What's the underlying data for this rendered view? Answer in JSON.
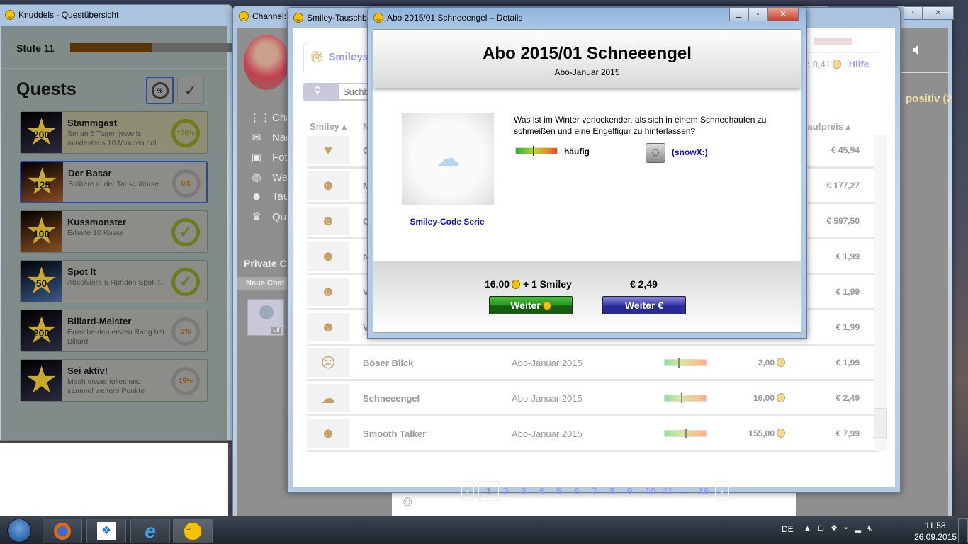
{
  "quest_window": {
    "title": "Knuddels - Questübersicht",
    "level_label": "Stufe 11",
    "level_progress": 0.5,
    "heading": "Quests",
    "filter_percent_icon": "%",
    "filter_check_icon": "✓",
    "quests": [
      {
        "points": "200",
        "title": "Stammgast",
        "desc": "Sei an 5 Tagen jeweils mindestens 10 Minuten onl...",
        "status": "100%",
        "done": false,
        "bg": "#2a2a40"
      },
      {
        "points": "125",
        "title": "Der Basar",
        "desc": "Stöbere in der Tauschbörse",
        "status": "0%",
        "done": false,
        "bg": "#8a4a20"
      },
      {
        "points": "100",
        "title": "Kussmonster",
        "desc": "Erhalte 10 Küsse",
        "status": "✓",
        "done": true,
        "bg": "#8a5020"
      },
      {
        "points": "50",
        "title": "Spot It",
        "desc": "Absolviere 5 Runden Spot It.",
        "status": "✓",
        "done": true,
        "bg": "#3a5a8a"
      },
      {
        "points": "200",
        "title": "Billard-Meister",
        "desc": "Erreiche den ersten Rang bei Billard",
        "status": "0%",
        "done": false,
        "bg": "#2a2a40"
      },
      {
        "points": "",
        "title": "Sei aktiv!",
        "desc": "Mach etwas tolles und sammel weitere Punkte",
        "status": "15%",
        "done": false,
        "bg": "#2a2a40"
      }
    ]
  },
  "channel_window": {
    "title": "Channel:",
    "menu": [
      {
        "icon": "grid-icon",
        "glyph": "⋮⋮",
        "label": "Cha"
      },
      {
        "icon": "mail-icon",
        "glyph": "✉",
        "label": "Nac"
      },
      {
        "icon": "photos-icon",
        "glyph": "▣",
        "label": "Fot"
      },
      {
        "icon": "globe-icon",
        "glyph": "◍",
        "label": "We"
      },
      {
        "icon": "trade-icon",
        "glyph": "☻",
        "label": "Tau"
      },
      {
        "icon": "trophy-icon",
        "glyph": "♛",
        "label": "Qu"
      }
    ],
    "private_chats_label": "Private C",
    "new_chat_label": "Neue Chat",
    "offline_badge": "off",
    "right_text": "positiv (2"
  },
  "tausch_window": {
    "title": "Smiley-Tauschb",
    "tab_label": "Smileys",
    "search_placeholder": "Suchb",
    "balance_label": "el:",
    "balance_value": "0,41",
    "help_link": "Hilfe",
    "columns": {
      "smiley": "Smiley ▴",
      "name": "N",
      "kaufpreis": "Kaufpreis ▴"
    },
    "rows": [
      {
        "name": "G",
        "category": "",
        "freq": null,
        "price": "",
        "kaufpreis": "€ 45,94",
        "glyph": "♥"
      },
      {
        "name": "M",
        "category": "",
        "freq": null,
        "price": "",
        "kaufpreis": "€ 177,27",
        "glyph": "☻"
      },
      {
        "name": "C",
        "category": "",
        "freq": null,
        "price": "",
        "kaufpreis": "€ 597,50",
        "glyph": "☻"
      },
      {
        "name": "N",
        "category": "",
        "freq": null,
        "price": "",
        "kaufpreis": "€ 1,99",
        "glyph": "☻"
      },
      {
        "name": "V",
        "category": "",
        "freq": null,
        "price": "",
        "kaufpreis": "€ 1,99",
        "glyph": "☻"
      },
      {
        "name": "V",
        "category": "",
        "freq": null,
        "price": "",
        "kaufpreis": "€ 1,99",
        "glyph": "☻"
      },
      {
        "name": "Böser Blick",
        "category": "Abo-Januar 2015",
        "freq": 0.33,
        "price": "2,00",
        "kaufpreis": "€ 1,99",
        "glyph": "☹"
      },
      {
        "name": "Schneeengel",
        "category": "Abo-Januar 2015",
        "freq": 0.4,
        "price": "16,00",
        "kaufpreis": "€ 2,49",
        "glyph": "☁"
      },
      {
        "name": "Smooth Talker",
        "category": "Abo-Januar 2015",
        "freq": 0.5,
        "price": "155,00",
        "kaufpreis": "€ 7,99",
        "glyph": "☻"
      }
    ],
    "pagination": {
      "current": "1",
      "pages": [
        "2",
        "3",
        "4",
        "5",
        "6",
        "7",
        "8",
        "9",
        "10",
        "11",
        "...",
        "16"
      ]
    }
  },
  "details_dialog": {
    "title": "Abo 2015/01 Schneeengel – Details",
    "heading": "Abo 2015/01 Schneeengel",
    "subheading": "Abo-Januar 2015",
    "series_link": "Smiley-Code Serie",
    "description": "Was ist im Winter verlockender, als sich in einem Schneehaufen zu schmeißen und eine Engelfigur zu hinterlassen?",
    "frequency_label": "häufig",
    "frequency": 0.42,
    "code": "(snowX:)",
    "knuddel_price": "16,00",
    "plus_label": "+ 1 Smiley",
    "euro_price": "€ 2,49",
    "button_knuddel": "Weiter",
    "button_euro": "Weiter"
  },
  "taskbar": {
    "language": "DE",
    "time": "11:58",
    "date": "26.09.2015"
  }
}
